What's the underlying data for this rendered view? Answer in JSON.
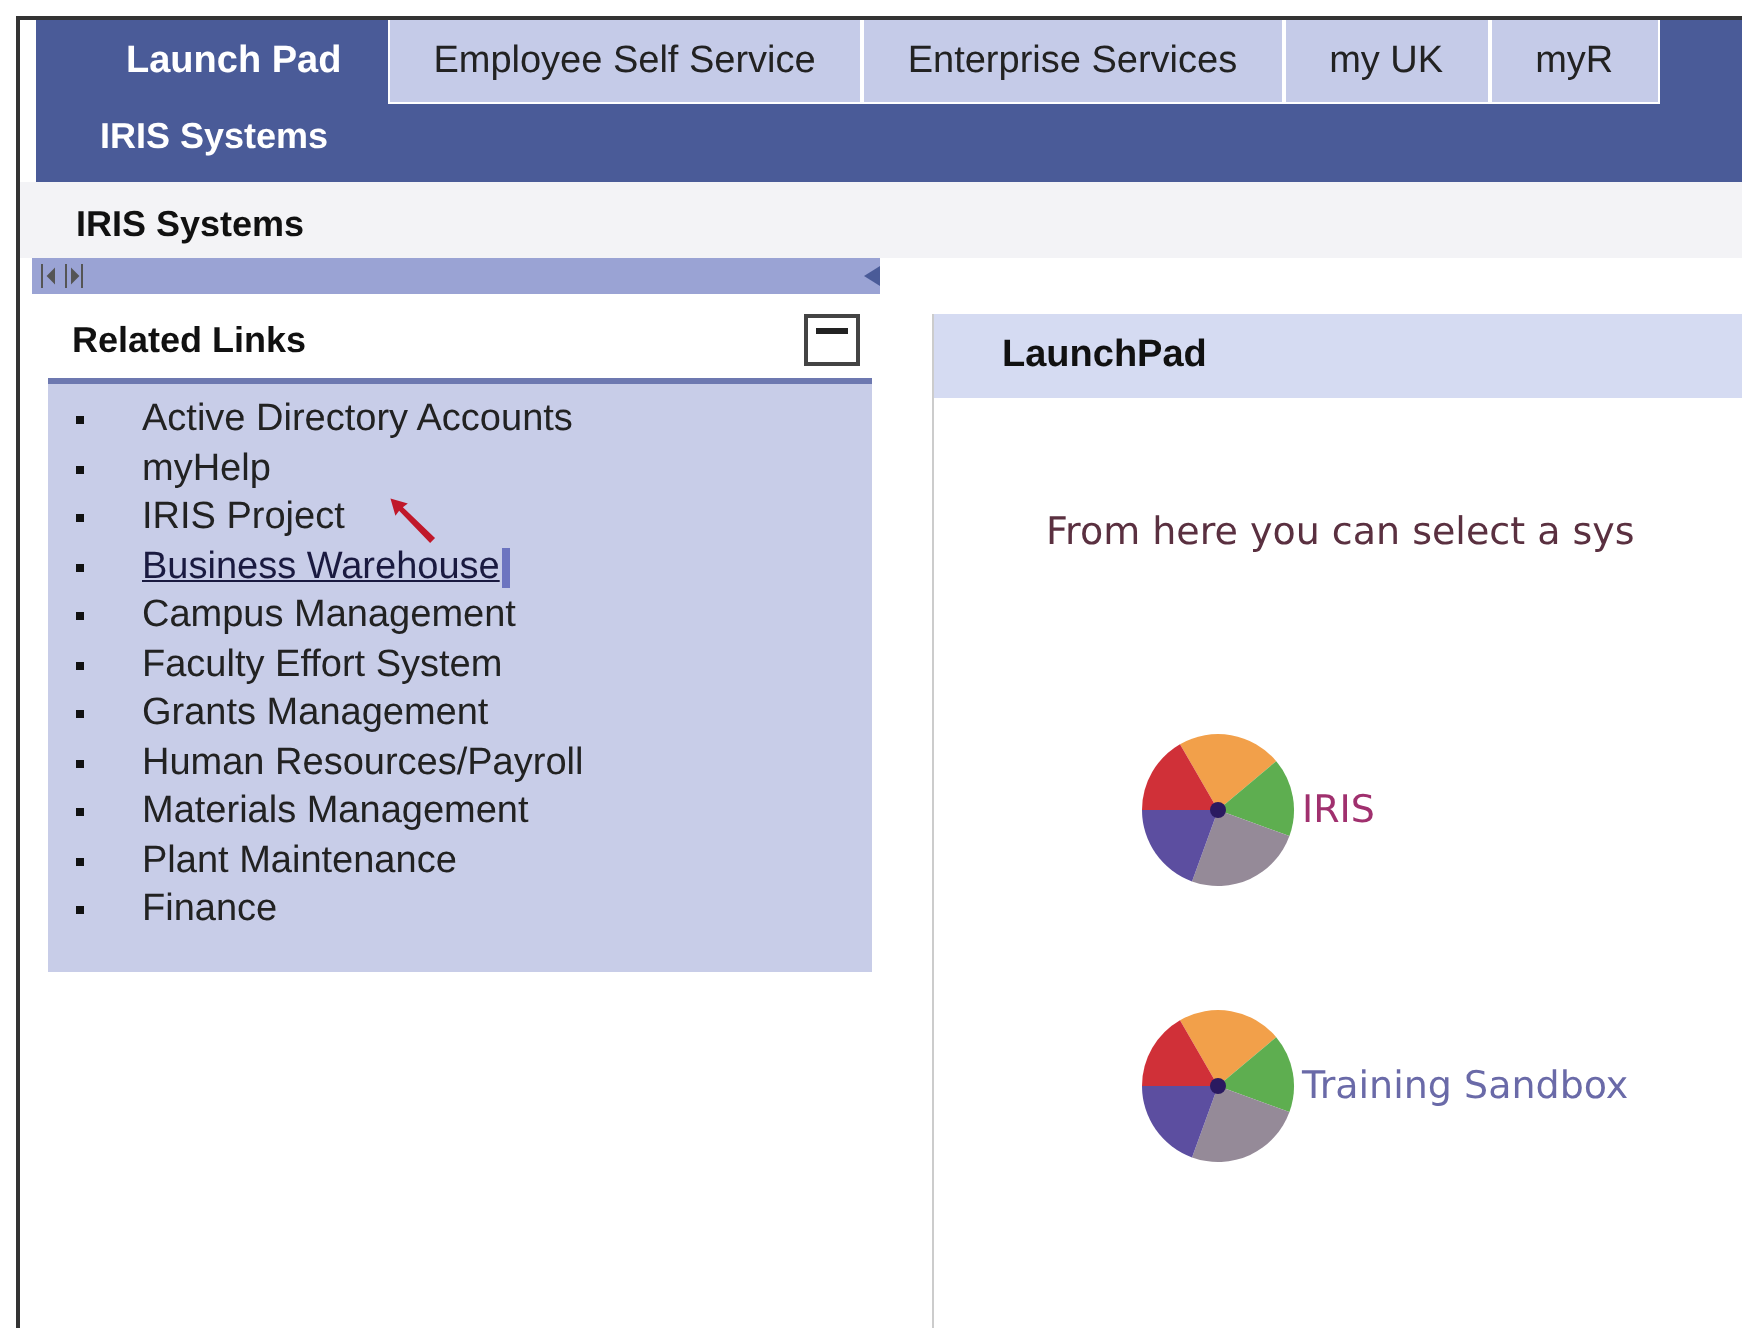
{
  "tabs": [
    {
      "label": "Launch Pad",
      "selected": true
    },
    {
      "label": "Employee Self Service",
      "selected": false
    },
    {
      "label": "Enterprise Services",
      "selected": false
    },
    {
      "label": "my UK",
      "selected": false
    },
    {
      "label": "myR",
      "selected": false
    }
  ],
  "sub_nav": {
    "items": [
      {
        "label": "IRIS Systems",
        "selected": true
      }
    ]
  },
  "breadcrumb": "IRIS Systems",
  "related_links": {
    "title": "Related Links",
    "expanded": true,
    "items": [
      {
        "label": "Active Directory Accounts",
        "hovered": false
      },
      {
        "label": "myHelp",
        "hovered": false
      },
      {
        "label": "IRIS Project",
        "hovered": false
      },
      {
        "label": "Business Warehouse",
        "hovered": true
      },
      {
        "label": "Campus Management",
        "hovered": false
      },
      {
        "label": "Faculty Effort System",
        "hovered": false
      },
      {
        "label": "Grants Management",
        "hovered": false
      },
      {
        "label": "Human Resources/Payroll",
        "hovered": false
      },
      {
        "label": "Materials Management",
        "hovered": false
      },
      {
        "label": "Plant Maintenance",
        "hovered": false
      },
      {
        "label": "Finance",
        "hovered": false
      }
    ]
  },
  "launchpad": {
    "title": "LaunchPad",
    "intro": "From here you can select a sys",
    "systems": [
      {
        "label": "IRIS",
        "color": "#a0306e"
      },
      {
        "label": "Training Sandbox",
        "color": "#6a6aa8"
      }
    ]
  }
}
